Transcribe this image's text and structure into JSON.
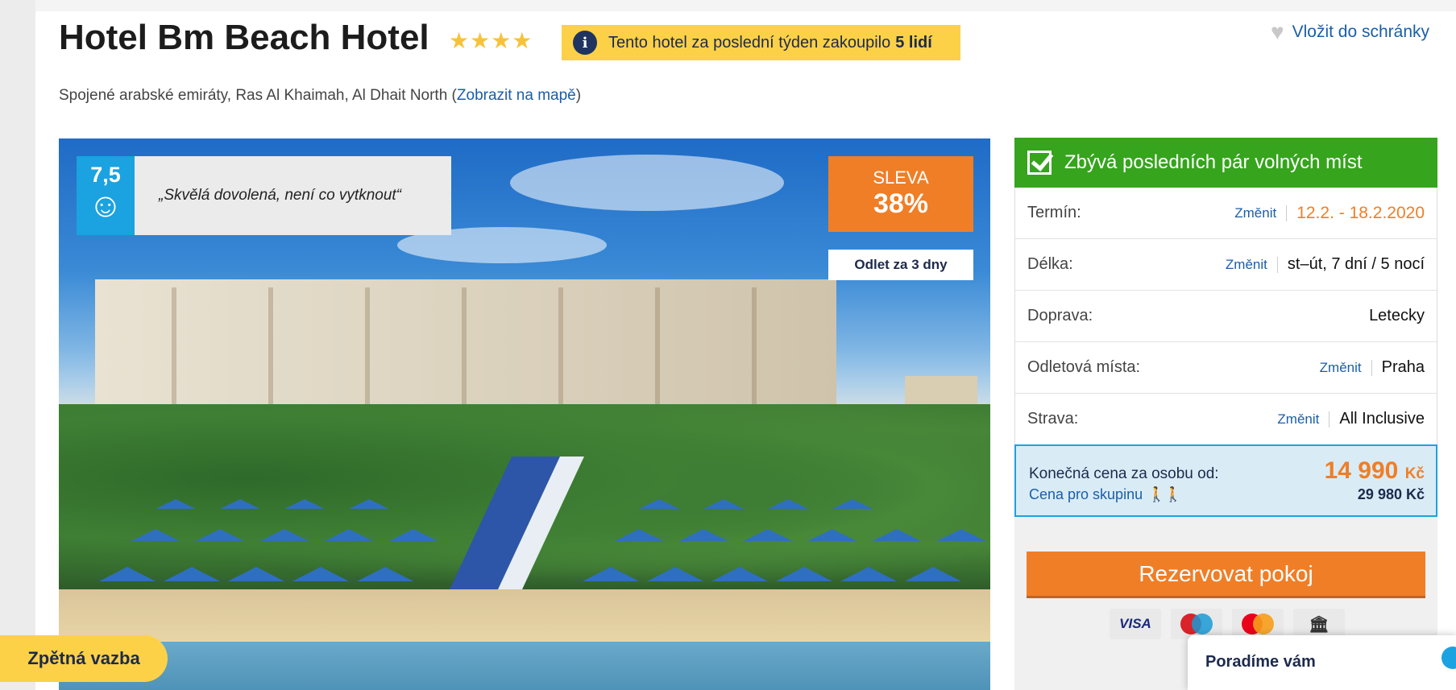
{
  "hotel": {
    "name": "Hotel Bm Beach Hotel",
    "stars": "★★★★",
    "location": "Spojené arabské emiráty, Ras Al Khaimah, Al Dhait North",
    "map_link": "Zobrazit na mapě"
  },
  "promo": {
    "text": "Tento hotel za poslední týden zakoupilo",
    "highlight": "5 lidí"
  },
  "wishlist": {
    "label": "Vložit do schránky"
  },
  "photo": {
    "rating": "7,5",
    "quote": "„Skvělá dovolená, není co vytknout“",
    "discount_label": "SLEVA",
    "discount_value": "38%",
    "departure": "Odlet za 3 dny"
  },
  "booking": {
    "availability": "Zbývá posledních pár volných míst",
    "change_label": "Změnit",
    "rows": [
      {
        "label": "Termín:",
        "value": "12.2. - 18.2.2020",
        "changeable": true
      },
      {
        "label": "Délka:",
        "value": "st–út, 7 dní / 5 nocí",
        "changeable": true
      },
      {
        "label": "Doprava:",
        "value": "Letecky",
        "changeable": false
      },
      {
        "label": "Odletová místa:",
        "value": "Praha",
        "changeable": true
      },
      {
        "label": "Strava:",
        "value": "All Inclusive",
        "changeable": true
      }
    ],
    "price_label": "Konečná cena za osobu od:",
    "price": "14 990",
    "currency": "Kč",
    "group_label": "Cena pro skupinu",
    "group_price": "29 980 Kč",
    "book_button": "Rezervovat pokoj",
    "cards": [
      "VISA",
      "Maestro",
      "MasterCard",
      "bank"
    ]
  },
  "chat": {
    "label": "Poradíme vám"
  },
  "feedback": {
    "label": "Zpětná vazba"
  }
}
